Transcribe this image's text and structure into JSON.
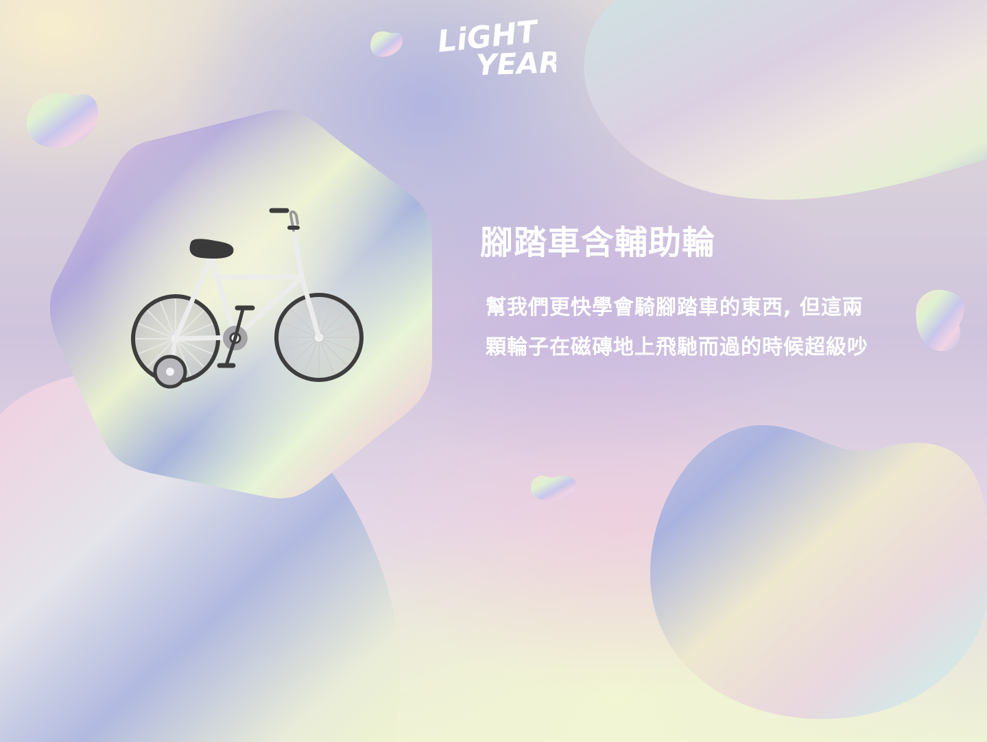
{
  "brand": {
    "logo_line1": "LiGHT",
    "logo_line2": "YEAR"
  },
  "product": {
    "title": "腳踏車含輔助輪",
    "description": "幫我們更快學會騎腳踏車的東西, 但這兩顆輪子在磁磚地上飛馳而過的時候超級吵",
    "image": "bicycle-with-training-wheels-icon"
  },
  "colors": {
    "text": "#ffffff",
    "frame": "#e8e8e8",
    "tire": "#3d3d3d",
    "seat": "#3a3a3a"
  }
}
